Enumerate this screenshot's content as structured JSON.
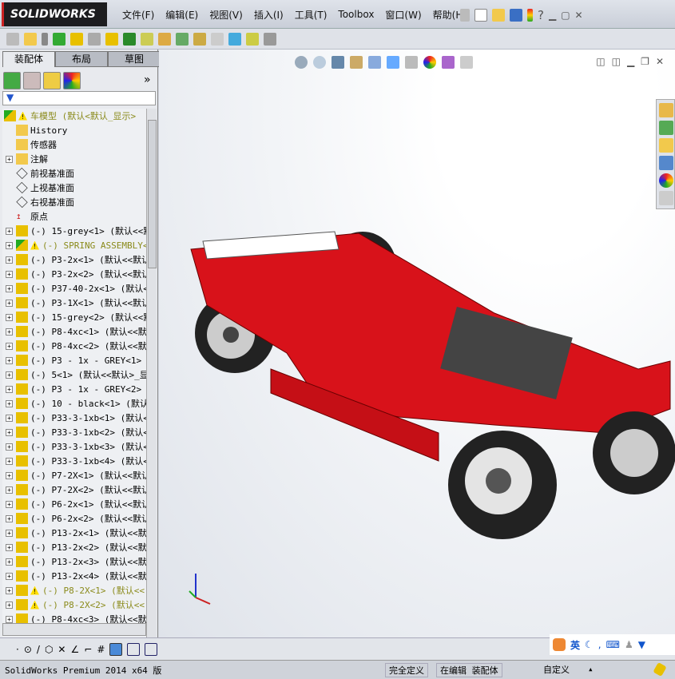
{
  "app": {
    "logo": "SOLIDWORKS"
  },
  "menu": [
    "文件(F)",
    "编辑(E)",
    "视图(V)",
    "插入(I)",
    "工具(T)",
    "Toolbox",
    "窗口(W)",
    "帮助(H)"
  ],
  "left_panel": {
    "tabs": [
      "装配体",
      "布局",
      "草图"
    ],
    "active_tab": "装配体",
    "filter_icon": "funnel-icon",
    "expand_label": "»",
    "tree": [
      {
        "text": "车模型  (默认<默认_显示>",
        "icon": "assembly",
        "warn": true,
        "olive": true,
        "root": true
      },
      {
        "text": "History",
        "icon": "history"
      },
      {
        "text": "传感器",
        "icon": "sensor"
      },
      {
        "text": "注解",
        "icon": "annotation",
        "expand": true
      },
      {
        "text": "前视基准面",
        "icon": "plane"
      },
      {
        "text": "上视基准面",
        "icon": "plane"
      },
      {
        "text": "右视基准面",
        "icon": "plane"
      },
      {
        "text": "原点",
        "icon": "origin"
      },
      {
        "text": "(-) 15-grey<1> (默认<<默",
        "icon": "part",
        "expand": true
      },
      {
        "text": "(-) SPRING ASSEMBLY<",
        "icon": "assembly",
        "warn": true,
        "olive": true,
        "expand": true
      },
      {
        "text": "(-) P3-2x<1> (默认<<默认",
        "icon": "part",
        "expand": true
      },
      {
        "text": "(-) P3-2x<2> (默认<<默认",
        "icon": "part",
        "expand": true
      },
      {
        "text": "(-) P37-40-2x<1> (默认<",
        "icon": "part",
        "expand": true
      },
      {
        "text": "(-) P3-1X<1> (默认<<默认",
        "icon": "part",
        "expand": true
      },
      {
        "text": "(-) 15-grey<2> (默认<<默",
        "icon": "part",
        "expand": true
      },
      {
        "text": "(-) P8-4xc<1> (默认<<默",
        "icon": "part",
        "expand": true
      },
      {
        "text": "(-) P8-4xc<2> (默认<<默",
        "icon": "part",
        "expand": true
      },
      {
        "text": "(-) P3 - 1x - GREY<1> (",
        "icon": "part",
        "expand": true
      },
      {
        "text": "(-) 5<1> (默认<<默认>_显",
        "icon": "part",
        "expand": true
      },
      {
        "text": "(-) P3 - 1x - GREY<2> (",
        "icon": "part",
        "expand": true
      },
      {
        "text": "(-) 10 - black<1> (默认",
        "icon": "part",
        "expand": true
      },
      {
        "text": "(-) P33-3-1xb<1> (默认<",
        "icon": "part",
        "expand": true
      },
      {
        "text": "(-) P33-3-1xb<2> (默认<",
        "icon": "part",
        "expand": true
      },
      {
        "text": "(-) P33-3-1xb<3> (默认<",
        "icon": "part",
        "expand": true
      },
      {
        "text": "(-) P33-3-1xb<4> (默认<",
        "icon": "part",
        "expand": true
      },
      {
        "text": "(-) P7-2X<1> (默认<<默认",
        "icon": "part",
        "expand": true
      },
      {
        "text": "(-) P7-2X<2> (默认<<默认",
        "icon": "part",
        "expand": true
      },
      {
        "text": "(-) P6-2x<1> (默认<<默认",
        "icon": "part",
        "expand": true
      },
      {
        "text": "(-) P6-2x<2> (默认<<默认",
        "icon": "part",
        "expand": true
      },
      {
        "text": "(-) P13-2x<1> (默认<<默",
        "icon": "part",
        "expand": true
      },
      {
        "text": "(-) P13-2x<2> (默认<<默",
        "icon": "part",
        "expand": true
      },
      {
        "text": "(-) P13-2x<3> (默认<<默",
        "icon": "part",
        "expand": true
      },
      {
        "text": "(-) P13-2x<4> (默认<<默",
        "icon": "part",
        "expand": true
      },
      {
        "text": "(-) P8-2X<1> (默认<<",
        "icon": "part",
        "warn": true,
        "olive": true,
        "expand": true
      },
      {
        "text": "(-) P8-2X<2> (默认<<",
        "icon": "part",
        "warn": true,
        "olive": true,
        "expand": true
      },
      {
        "text": "(-) P8-4xc<3> (默认<<默",
        "icon": "part",
        "expand": true
      }
    ]
  },
  "status": {
    "version": "SolidWorks Premium 2014 x64 版",
    "state": "完全定义",
    "editing": "在编辑 装配体",
    "units": "自定义",
    "arrow": "▴"
  },
  "ime": {
    "label": "英"
  },
  "colors": {
    "part": "#e8c000",
    "car_red": "#d8121a",
    "accent": "#1d1d1f"
  }
}
